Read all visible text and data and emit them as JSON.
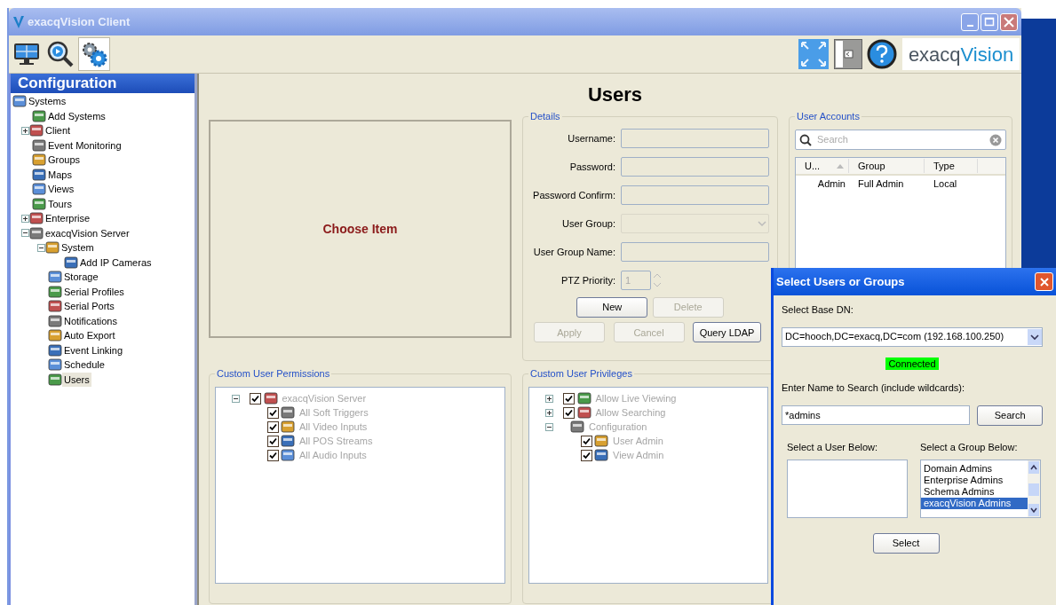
{
  "window": {
    "title": "exacqVision Client"
  },
  "toolbar": {
    "tools": [
      {
        "kind": "live",
        "selected": false
      },
      {
        "kind": "search",
        "selected": false
      },
      {
        "kind": "config",
        "selected": true
      }
    ],
    "logo": [
      "exacq",
      "Vision"
    ]
  },
  "sidebar": {
    "title": "Configuration",
    "items": [
      {
        "label": "Systems",
        "kind": "root",
        "selected": false,
        "children": [
          {
            "label": "Add Systems",
            "kind": "leaf",
            "selected": false
          },
          {
            "label": "Client",
            "kind": "node",
            "expanded": false,
            "selected": false
          },
          {
            "label": "Event Monitoring",
            "kind": "leaf",
            "selected": false
          },
          {
            "label": "Groups",
            "kind": "leaf",
            "selected": false
          },
          {
            "label": "Maps",
            "kind": "leaf",
            "selected": false
          },
          {
            "label": "Views",
            "kind": "leaf",
            "selected": false
          },
          {
            "label": "Tours",
            "kind": "leaf",
            "selected": false
          },
          {
            "label": "Enterprise",
            "kind": "node",
            "expanded": false,
            "selected": false
          },
          {
            "label": "exacqVision Server",
            "kind": "node",
            "expanded": true,
            "selected": false,
            "children": [
              {
                "label": "System",
                "kind": "node",
                "expanded": true,
                "selected": false,
                "children": [
                  {
                    "label": "Add IP Cameras",
                    "kind": "leaf",
                    "selected": false
                  }
                ]
              },
              {
                "label": "Storage",
                "kind": "leaf",
                "selected": false
              },
              {
                "label": "Serial Profiles",
                "kind": "leaf",
                "selected": false
              },
              {
                "label": "Serial Ports",
                "kind": "leaf",
                "selected": false
              },
              {
                "label": "Notifications",
                "kind": "leaf",
                "selected": false
              },
              {
                "label": "Auto Export",
                "kind": "leaf",
                "selected": false
              },
              {
                "label": "Event Linking",
                "kind": "leaf",
                "selected": false
              },
              {
                "label": "Schedule",
                "kind": "leaf",
                "selected": false
              },
              {
                "label": "Users",
                "kind": "leaf",
                "selected": true
              }
            ]
          }
        ]
      }
    ]
  },
  "main": {
    "title": "Users",
    "placeholder_text": "Choose Item",
    "details": {
      "title": "Details",
      "fields": [
        {
          "label": "Username:",
          "kind": "text"
        },
        {
          "label": "Password:",
          "kind": "text"
        },
        {
          "label": "Password Confirm:",
          "kind": "text"
        },
        {
          "label": "User Group:",
          "kind": "select"
        },
        {
          "label": "User Group Name:",
          "kind": "text"
        },
        {
          "label": "PTZ Priority:",
          "kind": "spin",
          "value": "1"
        }
      ],
      "buttons": [
        [
          {
            "label": "New",
            "disabled": false
          },
          {
            "label": "Delete",
            "disabled": true
          }
        ],
        [
          {
            "label": "Apply",
            "disabled": true
          },
          {
            "label": "Cancel",
            "disabled": true
          },
          {
            "label": "Query LDAP",
            "disabled": false
          }
        ]
      ]
    },
    "user_accounts": {
      "title": "User Accounts",
      "search": {
        "placeholder": "Search"
      },
      "columns": [
        "U...",
        "Group",
        "Type"
      ],
      "rows": [
        [
          "Admin",
          "Full Admin",
          "Local"
        ]
      ]
    },
    "permissions": {
      "title": "Custom User Permissions",
      "disabled": true,
      "items": [
        {
          "label": "exacqVision Server",
          "kind": "check",
          "checked": true,
          "expanded": true,
          "children": [
            {
              "label": "All Soft Triggers",
              "kind": "check",
              "checked": true
            },
            {
              "label": "All Video Inputs",
              "kind": "check",
              "checked": true
            },
            {
              "label": "All POS Streams",
              "kind": "check",
              "checked": true
            },
            {
              "label": "All Audio Inputs",
              "kind": "check",
              "checked": true
            }
          ]
        }
      ]
    },
    "privileges": {
      "title": "Custom User Privileges",
      "disabled": true,
      "items": [
        {
          "label": "Allow Live Viewing",
          "kind": "check",
          "checked": true,
          "expanded": false
        },
        {
          "label": "Allow Searching",
          "kind": "check",
          "checked": true,
          "expanded": false
        },
        {
          "label": "Configuration",
          "kind": "group",
          "expanded": true,
          "children": [
            {
              "label": "User Admin",
              "kind": "check",
              "checked": true
            },
            {
              "label": "View Admin",
              "kind": "check",
              "checked": true
            }
          ]
        }
      ]
    }
  },
  "dialog": {
    "title": "Select Users or Groups",
    "base_dn_label": "Select Base DN:",
    "base_dn": "DC=hooch,DC=exacq,DC=com (192.168.100.250)",
    "status": "Connected",
    "search_label": "Enter Name to Search (include wildcards):",
    "search_value": "*admins",
    "search_button": "Search",
    "user_list_label": "Select a User Below:",
    "group_list_label": "Select a Group Below:",
    "groups": [
      {
        "label": "Domain Admins",
        "selected": false
      },
      {
        "label": "Enterprise Admins",
        "selected": false
      },
      {
        "label": "Schema Admins",
        "selected": false
      },
      {
        "label": "exacqVision Admins",
        "selected": true
      }
    ],
    "select_button": "Select"
  }
}
